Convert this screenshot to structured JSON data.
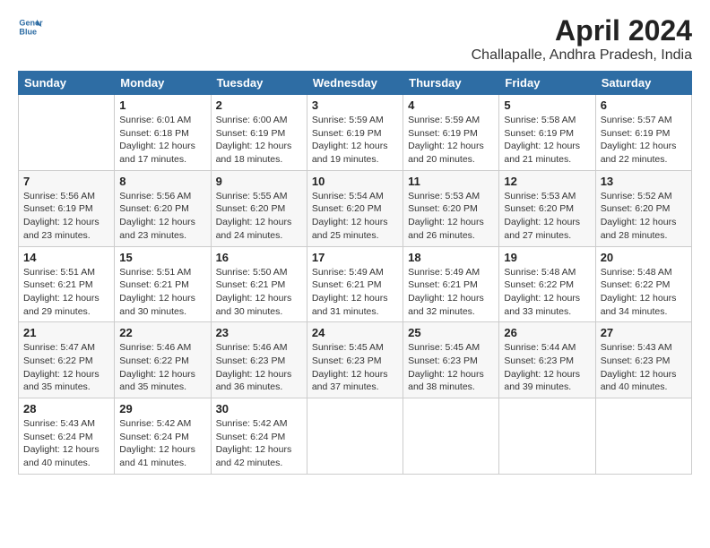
{
  "header": {
    "logo_line1": "General",
    "logo_line2": "Blue",
    "month": "April 2024",
    "location": "Challapalle, Andhra Pradesh, India"
  },
  "weekdays": [
    "Sunday",
    "Monday",
    "Tuesday",
    "Wednesday",
    "Thursday",
    "Friday",
    "Saturday"
  ],
  "weeks": [
    [
      {
        "day": "",
        "info": ""
      },
      {
        "day": "1",
        "info": "Sunrise: 6:01 AM\nSunset: 6:18 PM\nDaylight: 12 hours\nand 17 minutes."
      },
      {
        "day": "2",
        "info": "Sunrise: 6:00 AM\nSunset: 6:19 PM\nDaylight: 12 hours\nand 18 minutes."
      },
      {
        "day": "3",
        "info": "Sunrise: 5:59 AM\nSunset: 6:19 PM\nDaylight: 12 hours\nand 19 minutes."
      },
      {
        "day": "4",
        "info": "Sunrise: 5:59 AM\nSunset: 6:19 PM\nDaylight: 12 hours\nand 20 minutes."
      },
      {
        "day": "5",
        "info": "Sunrise: 5:58 AM\nSunset: 6:19 PM\nDaylight: 12 hours\nand 21 minutes."
      },
      {
        "day": "6",
        "info": "Sunrise: 5:57 AM\nSunset: 6:19 PM\nDaylight: 12 hours\nand 22 minutes."
      }
    ],
    [
      {
        "day": "7",
        "info": "Sunrise: 5:56 AM\nSunset: 6:19 PM\nDaylight: 12 hours\nand 23 minutes."
      },
      {
        "day": "8",
        "info": "Sunrise: 5:56 AM\nSunset: 6:20 PM\nDaylight: 12 hours\nand 23 minutes."
      },
      {
        "day": "9",
        "info": "Sunrise: 5:55 AM\nSunset: 6:20 PM\nDaylight: 12 hours\nand 24 minutes."
      },
      {
        "day": "10",
        "info": "Sunrise: 5:54 AM\nSunset: 6:20 PM\nDaylight: 12 hours\nand 25 minutes."
      },
      {
        "day": "11",
        "info": "Sunrise: 5:53 AM\nSunset: 6:20 PM\nDaylight: 12 hours\nand 26 minutes."
      },
      {
        "day": "12",
        "info": "Sunrise: 5:53 AM\nSunset: 6:20 PM\nDaylight: 12 hours\nand 27 minutes."
      },
      {
        "day": "13",
        "info": "Sunrise: 5:52 AM\nSunset: 6:20 PM\nDaylight: 12 hours\nand 28 minutes."
      }
    ],
    [
      {
        "day": "14",
        "info": "Sunrise: 5:51 AM\nSunset: 6:21 PM\nDaylight: 12 hours\nand 29 minutes."
      },
      {
        "day": "15",
        "info": "Sunrise: 5:51 AM\nSunset: 6:21 PM\nDaylight: 12 hours\nand 30 minutes."
      },
      {
        "day": "16",
        "info": "Sunrise: 5:50 AM\nSunset: 6:21 PM\nDaylight: 12 hours\nand 30 minutes."
      },
      {
        "day": "17",
        "info": "Sunrise: 5:49 AM\nSunset: 6:21 PM\nDaylight: 12 hours\nand 31 minutes."
      },
      {
        "day": "18",
        "info": "Sunrise: 5:49 AM\nSunset: 6:21 PM\nDaylight: 12 hours\nand 32 minutes."
      },
      {
        "day": "19",
        "info": "Sunrise: 5:48 AM\nSunset: 6:22 PM\nDaylight: 12 hours\nand 33 minutes."
      },
      {
        "day": "20",
        "info": "Sunrise: 5:48 AM\nSunset: 6:22 PM\nDaylight: 12 hours\nand 34 minutes."
      }
    ],
    [
      {
        "day": "21",
        "info": "Sunrise: 5:47 AM\nSunset: 6:22 PM\nDaylight: 12 hours\nand 35 minutes."
      },
      {
        "day": "22",
        "info": "Sunrise: 5:46 AM\nSunset: 6:22 PM\nDaylight: 12 hours\nand 35 minutes."
      },
      {
        "day": "23",
        "info": "Sunrise: 5:46 AM\nSunset: 6:23 PM\nDaylight: 12 hours\nand 36 minutes."
      },
      {
        "day": "24",
        "info": "Sunrise: 5:45 AM\nSunset: 6:23 PM\nDaylight: 12 hours\nand 37 minutes."
      },
      {
        "day": "25",
        "info": "Sunrise: 5:45 AM\nSunset: 6:23 PM\nDaylight: 12 hours\nand 38 minutes."
      },
      {
        "day": "26",
        "info": "Sunrise: 5:44 AM\nSunset: 6:23 PM\nDaylight: 12 hours\nand 39 minutes."
      },
      {
        "day": "27",
        "info": "Sunrise: 5:43 AM\nSunset: 6:23 PM\nDaylight: 12 hours\nand 40 minutes."
      }
    ],
    [
      {
        "day": "28",
        "info": "Sunrise: 5:43 AM\nSunset: 6:24 PM\nDaylight: 12 hours\nand 40 minutes."
      },
      {
        "day": "29",
        "info": "Sunrise: 5:42 AM\nSunset: 6:24 PM\nDaylight: 12 hours\nand 41 minutes."
      },
      {
        "day": "30",
        "info": "Sunrise: 5:42 AM\nSunset: 6:24 PM\nDaylight: 12 hours\nand 42 minutes."
      },
      {
        "day": "",
        "info": ""
      },
      {
        "day": "",
        "info": ""
      },
      {
        "day": "",
        "info": ""
      },
      {
        "day": "",
        "info": ""
      }
    ]
  ]
}
